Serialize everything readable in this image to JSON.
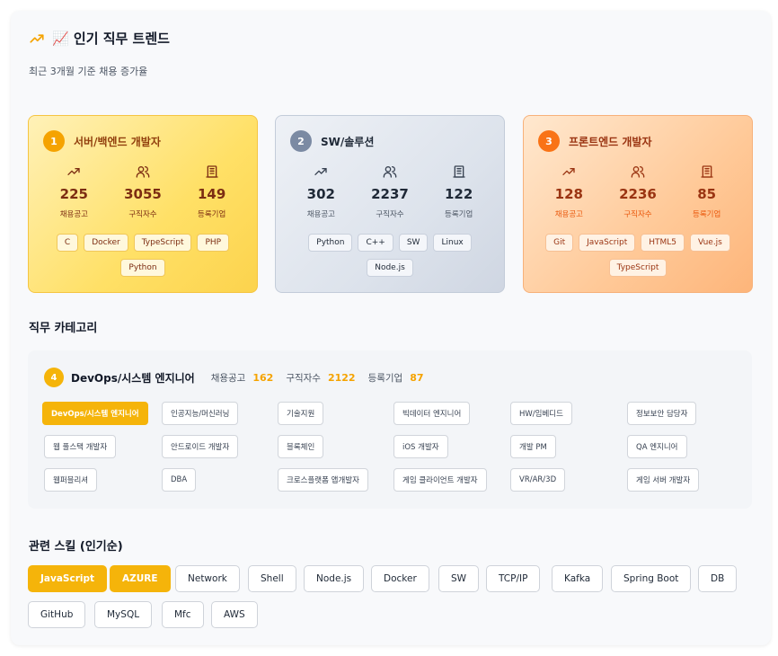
{
  "header": {
    "title": "📈 인기 직무 트렌드",
    "subtitle": "최근 3개월 기준 채용 증가율"
  },
  "top_jobs": [
    {
      "rank": "1",
      "name": "서버/백엔드 개발자",
      "stats": [
        {
          "value": "225",
          "label": "채용공고"
        },
        {
          "value": "3055",
          "label": "구직자수"
        },
        {
          "value": "149",
          "label": "등록기업"
        }
      ],
      "skills": [
        "C",
        "Docker",
        "TypeScript",
        "PHP",
        "Python"
      ]
    },
    {
      "rank": "2",
      "name": "SW/솔루션",
      "stats": [
        {
          "value": "302",
          "label": "채용공고"
        },
        {
          "value": "2237",
          "label": "구직자수"
        },
        {
          "value": "122",
          "label": "등록기업"
        }
      ],
      "skills": [
        "Python",
        "C++",
        "SW",
        "Linux",
        "Node.js"
      ]
    },
    {
      "rank": "3",
      "name": "프론트엔드 개발자",
      "stats": [
        {
          "value": "128",
          "label": "채용공고"
        },
        {
          "value": "2236",
          "label": "구직자수"
        },
        {
          "value": "85",
          "label": "등록기업"
        }
      ],
      "skills": [
        "Git",
        "JavaScript",
        "HTML5",
        "Vue.js",
        "TypeScript"
      ]
    }
  ],
  "category_section": {
    "title": "직무 카테고리",
    "selected": {
      "rank": "4",
      "name": "DevOps/시스템 엔지니어",
      "postings_label": "채용공고",
      "postings": "162",
      "seekers_label": "구직자수",
      "seekers": "2122",
      "companies_label": "등록기업",
      "companies": "87"
    },
    "items": [
      "DevOps/시스템 엔지니어",
      "인공지능/머신러닝",
      "기술지원",
      "빅데이터 엔지니어",
      "HW/임베디드",
      "정보보안 담당자",
      "웹 풀스택 개발자",
      "안드로이드 개발자",
      "블록체인",
      "iOS 개발자",
      "개발 PM",
      "QA 엔지니어",
      "웹퍼블리셔",
      "DBA",
      "크로스플랫폼 앱개발자",
      "게임 클라이언트 개발자",
      "VR/AR/3D",
      "게임 서버 개발자"
    ]
  },
  "skills_section": {
    "title": "관련 스킬 (인기순)",
    "skills": [
      "JavaScript",
      "AZURE",
      "Network",
      "Shell",
      "Node.js",
      "Docker",
      "SW",
      "TCP/IP",
      "Kafka",
      "Spring Boot",
      "DB",
      "GitHub",
      "MySQL",
      "Mfc",
      "AWS"
    ]
  },
  "colors": {
    "accent": "#f5b40a",
    "gold": "#f5a300",
    "silver": "#7b8aa3",
    "bronze": "#f97316"
  },
  "icons": {
    "trend": "trending-up-icon",
    "chart": "chart-emoji-icon",
    "postings": "trending-up-icon",
    "seekers": "users-icon",
    "companies": "building-icon"
  }
}
